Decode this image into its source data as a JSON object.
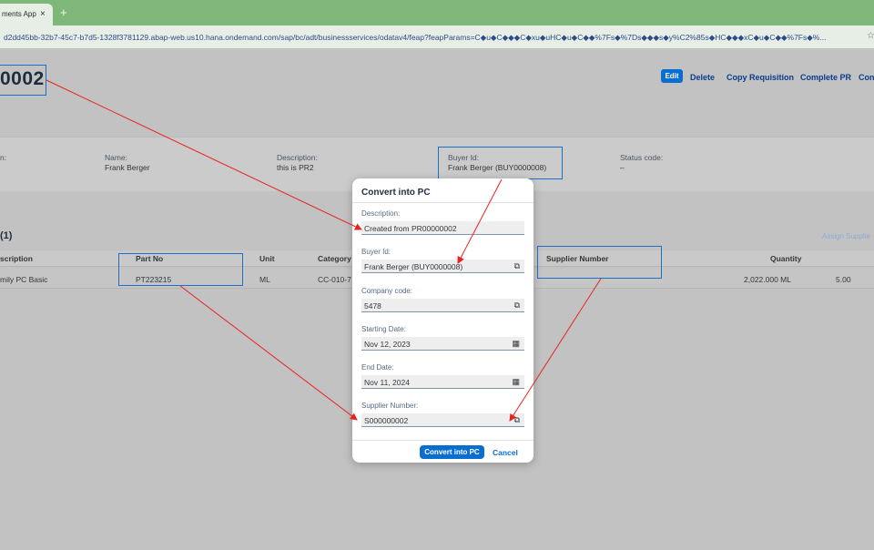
{
  "browser": {
    "tab_title": "ments App",
    "tab_close": "×",
    "new_tab": "+",
    "url": "d2dd45bb-32b7-45c7-b7d5-1328f3781129.abap-web.us10.hana.ondemand.com/sap/bc/adt/businessservices/odatav4/feap?feapParams=C◆u◆C◆◆◆C◆xu◆uHC◆u◆C◆◆%7Fs◆%7Ds◆◆◆s◆y%C2%85s◆HC◆◆◆xC◆u◆C◆◆%7Fs◆%...",
    "star": "☆"
  },
  "header": {
    "title": "0002",
    "actions": {
      "edit": "Edit",
      "delete": "Delete",
      "copy": "Copy Requisition",
      "complete": "Complete PR",
      "more": "Con"
    }
  },
  "fields": {
    "first_label": "n:",
    "name_label": "Name:",
    "name_value": "Frank Berger",
    "description_label": "Description:",
    "description_value": "this is PR2",
    "buyer_label": "Buyer Id:",
    "buyer_value": "Frank Berger (BUY0000008)",
    "status_label": "Status code:",
    "status_value": "–"
  },
  "items": {
    "section_title": "(1)",
    "assign_link": "Assign Supplie",
    "columns": {
      "description": "scription",
      "part_no": "Part No",
      "unit": "Unit",
      "category": "Category",
      "supplier": "Supplier Number",
      "quantity": "Quantity"
    },
    "row": {
      "description": "mily PC Basic",
      "part_no": "PT223215",
      "unit": "ML",
      "category": "CC-010-7",
      "quantity": "2,022.000 ML",
      "price": "5.00"
    }
  },
  "dialog": {
    "title": "Convert into PC",
    "description_label": "Description:",
    "description_value": "Created from PR00000002",
    "buyer_label": "Buyer Id:",
    "buyer_value": "Frank Berger (BUY0000008)",
    "company_label": "Company code:",
    "company_value": "5478",
    "start_label": "Starting Date:",
    "start_value": "Nov 12, 2023",
    "end_label": "End Date:",
    "end_value": "Nov 11, 2024",
    "supplier_label": "Supplier Number:",
    "supplier_value": "S000000002",
    "value_help_icon": "⧉",
    "calendar_icon": "▦",
    "convert_button": "Convert into PC",
    "cancel_button": "Cancel"
  },
  "colors": {
    "accent": "#0a6ed1",
    "highlight": "#1f6fc8",
    "annotation_arrow": "#e8231f"
  }
}
